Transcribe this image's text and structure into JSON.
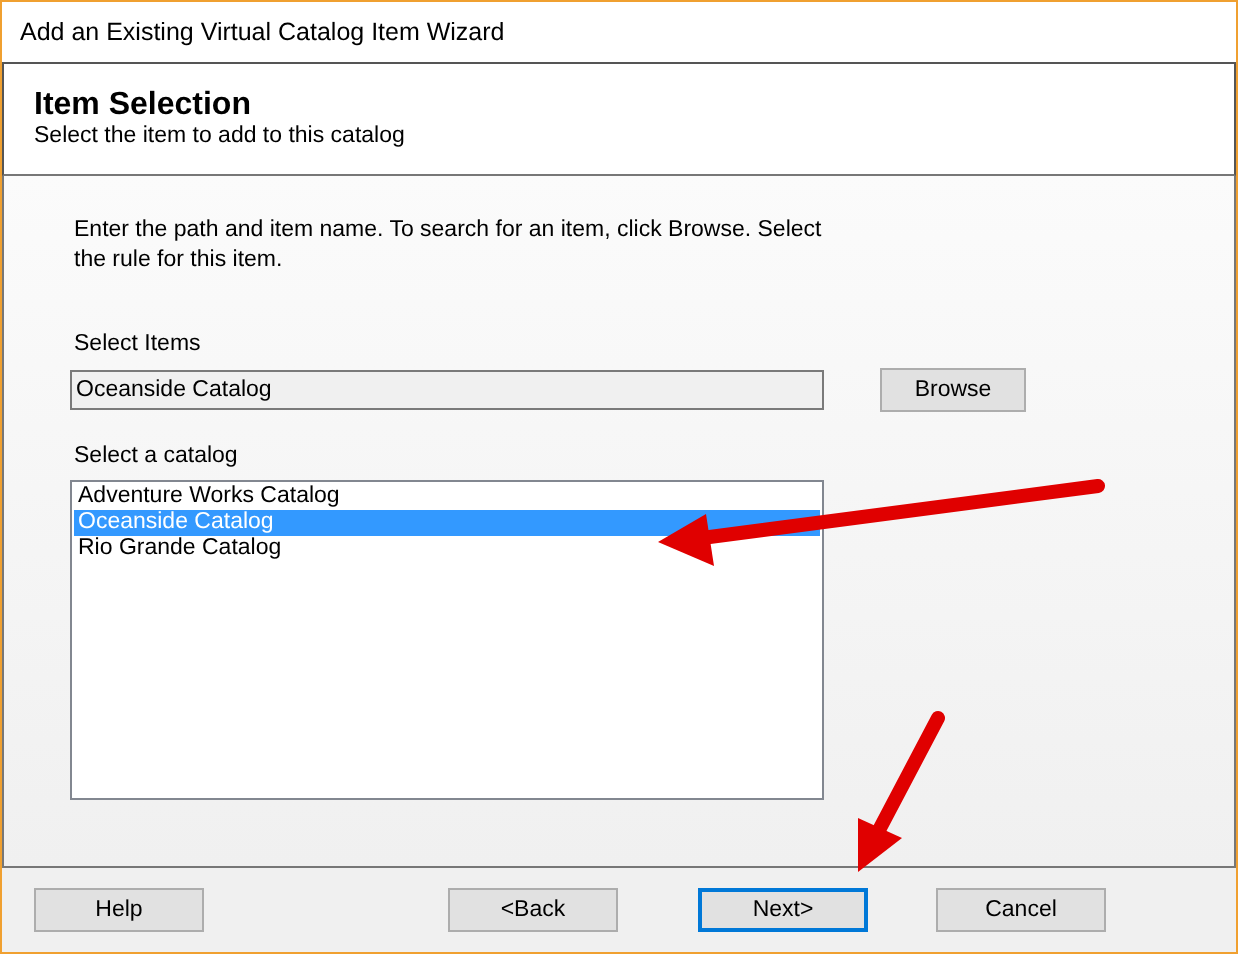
{
  "window": {
    "title": "Add an Existing Virtual Catalog Item Wizard"
  },
  "header": {
    "title": "Item Selection",
    "subtitle": "Select the item to add to this catalog"
  },
  "instructions": "Enter the path and item name. To search for an item, click Browse. Select the rule for this item.",
  "select_items": {
    "label": "Select Items",
    "value": "Oceanside Catalog",
    "browse_button": "Browse"
  },
  "catalog_list": {
    "label": "Select a catalog",
    "items": [
      {
        "label": "Adventure Works Catalog",
        "selected": false
      },
      {
        "label": "Oceanside Catalog",
        "selected": true
      },
      {
        "label": "Rio Grande Catalog",
        "selected": false
      }
    ]
  },
  "buttons": [
    {
      "label": "Help",
      "default": false
    },
    {
      "label": "<Back",
      "default": false
    },
    {
      "label": "Next>",
      "default": true
    },
    {
      "label": "Cancel",
      "default": false
    }
  ]
}
